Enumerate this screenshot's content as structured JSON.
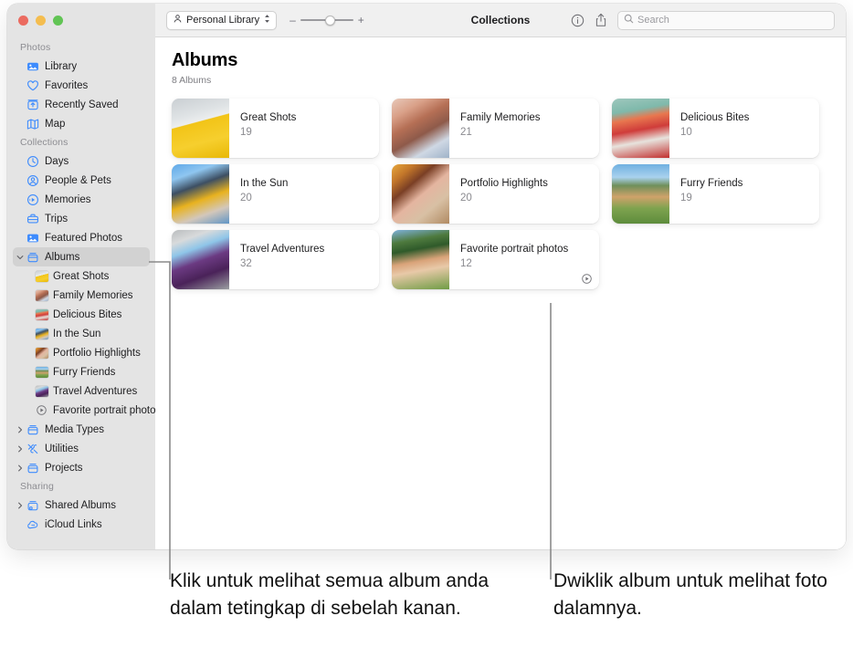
{
  "window": {
    "traffic_lights": [
      "close",
      "minimize",
      "zoom"
    ]
  },
  "toolbar": {
    "library_button": "Personal Library",
    "zoom_minus": "–",
    "zoom_plus": "+",
    "title": "Collections",
    "info_icon": "info-icon",
    "share_icon": "share-icon",
    "search_placeholder": "Search",
    "search_value": ""
  },
  "sidebar": {
    "sections": [
      {
        "label": "Photos",
        "items": [
          {
            "label": "Library",
            "icon": "library-icon",
            "level": 0,
            "selected": false,
            "expandable": false
          },
          {
            "label": "Favorites",
            "icon": "heart-icon",
            "level": 0,
            "selected": false,
            "expandable": false
          },
          {
            "label": "Recently Saved",
            "icon": "recently-saved-icon",
            "level": 0,
            "selected": false,
            "expandable": false
          },
          {
            "label": "Map",
            "icon": "map-icon",
            "level": 0,
            "selected": false,
            "expandable": false
          }
        ]
      },
      {
        "label": "Collections",
        "items": [
          {
            "label": "Days",
            "icon": "clock-icon",
            "level": 0,
            "selected": false,
            "expandable": false
          },
          {
            "label": "People & Pets",
            "icon": "person-circle-icon",
            "level": 0,
            "selected": false,
            "expandable": false
          },
          {
            "label": "Memories",
            "icon": "memories-icon",
            "level": 0,
            "selected": false,
            "expandable": false
          },
          {
            "label": "Trips",
            "icon": "trips-icon",
            "level": 0,
            "selected": false,
            "expandable": false
          },
          {
            "label": "Featured Photos",
            "icon": "featured-photos-icon",
            "level": 0,
            "selected": false,
            "expandable": false
          },
          {
            "label": "Albums",
            "icon": "albums-icon",
            "level": 0,
            "selected": true,
            "expandable": true,
            "expanded": true
          },
          {
            "label": "Great Shots",
            "icon": "album-thumb",
            "thumb": "img-great",
            "level": 1,
            "selected": false,
            "expandable": false
          },
          {
            "label": "Family Memories",
            "icon": "album-thumb",
            "thumb": "img-family",
            "level": 1,
            "selected": false,
            "expandable": false
          },
          {
            "label": "Delicious Bites",
            "icon": "album-thumb",
            "thumb": "img-delicious",
            "level": 1,
            "selected": false,
            "expandable": false
          },
          {
            "label": "In the Sun",
            "icon": "album-thumb",
            "thumb": "img-sun",
            "level": 1,
            "selected": false,
            "expandable": false
          },
          {
            "label": "Portfolio Highlights",
            "icon": "album-thumb",
            "thumb": "img-portfolio",
            "level": 1,
            "selected": false,
            "expandable": false
          },
          {
            "label": "Furry Friends",
            "icon": "album-thumb",
            "thumb": "img-furry",
            "level": 1,
            "selected": false,
            "expandable": false
          },
          {
            "label": "Travel Adventures",
            "icon": "album-thumb",
            "thumb": "img-travel",
            "level": 1,
            "selected": false,
            "expandable": false
          },
          {
            "label": "Favorite portrait photos",
            "icon": "smart-album-icon",
            "level": 1,
            "selected": false,
            "expandable": false
          },
          {
            "label": "Media Types",
            "icon": "media-types-icon",
            "level": 0,
            "selected": false,
            "expandable": true,
            "expanded": false
          },
          {
            "label": "Utilities",
            "icon": "utilities-icon",
            "level": 0,
            "selected": false,
            "expandable": true,
            "expanded": false
          },
          {
            "label": "Projects",
            "icon": "projects-icon",
            "level": 0,
            "selected": false,
            "expandable": true,
            "expanded": false
          }
        ]
      },
      {
        "label": "Sharing",
        "items": [
          {
            "label": "Shared Albums",
            "icon": "shared-albums-icon",
            "level": 0,
            "selected": false,
            "expandable": true,
            "expanded": false
          },
          {
            "label": "iCloud Links",
            "icon": "icloud-icon",
            "level": 0,
            "selected": false,
            "expandable": false
          }
        ]
      }
    ]
  },
  "main": {
    "title": "Albums",
    "subtitle": "8 Albums",
    "albums": [
      {
        "title": "Great Shots",
        "count": "19",
        "thumb": "img-great",
        "badge": null
      },
      {
        "title": "Family Memories",
        "count": "21",
        "thumb": "img-family",
        "badge": null
      },
      {
        "title": "Delicious Bites",
        "count": "10",
        "thumb": "img-delicious",
        "badge": null
      },
      {
        "title": "In the Sun",
        "count": "20",
        "thumb": "img-sun",
        "badge": null
      },
      {
        "title": "Portfolio Highlights",
        "count": "20",
        "thumb": "img-portfolio",
        "badge": null
      },
      {
        "title": "Furry Friends",
        "count": "19",
        "thumb": "img-furry",
        "badge": null
      },
      {
        "title": "Travel Adventures",
        "count": "32",
        "thumb": "img-travel",
        "badge": null
      },
      {
        "title": "Favorite portrait photos",
        "count": "12",
        "thumb": "img-favorite",
        "badge": "smart-album-icon"
      }
    ]
  },
  "callouts": [
    {
      "text": "Klik untuk melihat semua album anda dalam tetingkap di sebelah kanan."
    },
    {
      "text": "Dwiklik album untuk melihat foto dalamnya."
    }
  ],
  "colors": {
    "accent": "#3d8bfd",
    "sidebar_bg": "#e4e4e4",
    "toolbar_bg": "#f0f0f0",
    "selection_bg": "#d2d2d2",
    "callout_line": "#8a8a8a"
  }
}
